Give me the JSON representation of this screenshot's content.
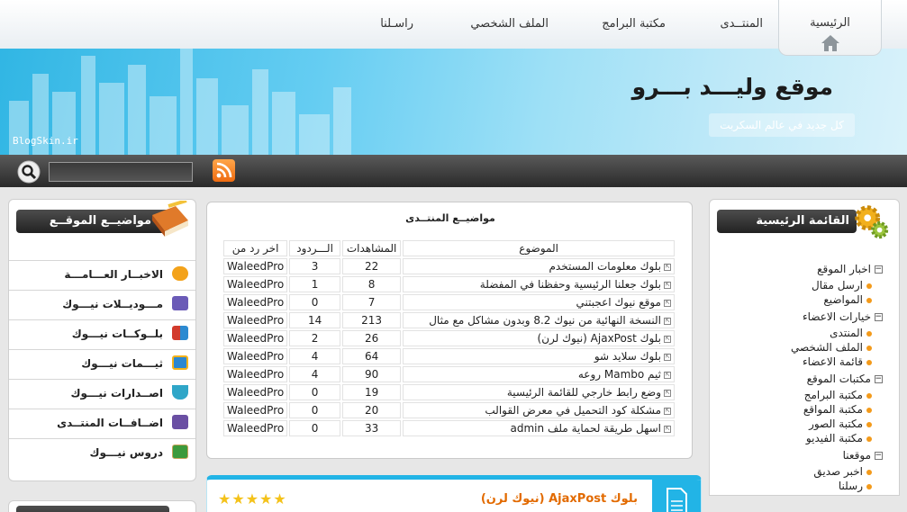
{
  "nav": {
    "home": "الرئيسية",
    "forum": "المنتــدى",
    "software": "مكتبة البرامج",
    "profile": "الملف الشخصي",
    "contact": "راسـلنا"
  },
  "banner": {
    "title": "موقع وليـــد بـــرو",
    "subtitle": "كل جديد في عالم السكربت",
    "credit": "BlogSkin.ir"
  },
  "search": {
    "value": ""
  },
  "left_panel": {
    "title": "مواضيــع الموقــع",
    "items": [
      {
        "label": "الاخبــار العـــامـــة",
        "icon": "speech-bubble-icon",
        "color": "#f3a21a"
      },
      {
        "label": "مـــوديــلات نيـــوك",
        "icon": "puzzle-icon",
        "color": "#6b5bb7"
      },
      {
        "label": "بلــوكــات نيـــوك",
        "icon": "blocks-icon",
        "color": "#d23b2d"
      },
      {
        "label": "ثيـــمات نيـــوك",
        "icon": "window-icon",
        "color": "#2b87d1"
      },
      {
        "label": "اصــدارات نيـــوك",
        "icon": "cup-icon",
        "color": "#2fa6c8"
      },
      {
        "label": "اضــافــات المنتــدى",
        "icon": "addons-icon",
        "color": "#6a4fa3"
      },
      {
        "label": "دروس نيـــوك",
        "icon": "abc-board-icon",
        "color": "#3c9a3c"
      }
    ]
  },
  "forum_topics": {
    "title": "مواضيــع المنتــدى",
    "headers": {
      "topic": "الموضوع",
      "views": "المشاهدات",
      "replies": "الـــردود",
      "last": "اخر رد من"
    },
    "rows": [
      {
        "topic": "بلوك معلومات المستخدم",
        "views": "22",
        "replies": "3",
        "last": "WaleedPro"
      },
      {
        "topic": "بلوك جعلنا الرئيسية وحفظنا في المفضلة",
        "views": "8",
        "replies": "1",
        "last": "WaleedPro"
      },
      {
        "topic": "موقع نيوك اعجبتني",
        "views": "7",
        "replies": "0",
        "last": "WaleedPro"
      },
      {
        "topic": "النسخة النهائية من نيوك 8.2 وبدون مشاكل مع مثال",
        "views": "213",
        "replies": "14",
        "last": "WaleedPro"
      },
      {
        "topic": "بلوك AjaxPost (نيوك لرن)",
        "views": "26",
        "replies": "2",
        "last": "WaleedPro"
      },
      {
        "topic": "بلوك سلايد شو",
        "views": "64",
        "replies": "4",
        "last": "WaleedPro"
      },
      {
        "topic": "ثيم Mambo روعه",
        "views": "90",
        "replies": "4",
        "last": "WaleedPro"
      },
      {
        "topic": "وضع رابط خارجي للقائمة الرئيسية",
        "views": "19",
        "replies": "0",
        "last": "WaleedPro"
      },
      {
        "topic": "مشكلة كود التحميل في معرض القوالب",
        "views": "20",
        "replies": "0",
        "last": "WaleedPro"
      },
      {
        "topic": "اسهل طريقة لحماية ملف admin",
        "views": "33",
        "replies": "0",
        "last": "WaleedPro"
      }
    ]
  },
  "main_menu": {
    "title": "القائمة الرئيسية",
    "groups": [
      {
        "label": "اخبار الموقع",
        "items": [
          "ارسل مقال",
          "المواضيع"
        ]
      },
      {
        "label": "خيارات الاعضاء",
        "items": [
          "المنتدى",
          "الملف الشخصي",
          "قائمة الاعضاء"
        ]
      },
      {
        "label": "مكتبات الموقع",
        "items": [
          "مكتبة البرامج",
          "مكتبة المواقع",
          "مكتبة الصور",
          "مكتبة الفيديو"
        ]
      },
      {
        "label": "موقعنا",
        "items": [
          "اخبر صديق",
          "رسلنا"
        ]
      }
    ]
  },
  "post": {
    "title": "بلوك AjaxPost (نيوك لرن)",
    "rating": 5,
    "stars": "★★★★★"
  },
  "colors": {
    "accent": "#22b4e6",
    "bullet": "#f39a1a",
    "post_title": "#e26a00"
  }
}
